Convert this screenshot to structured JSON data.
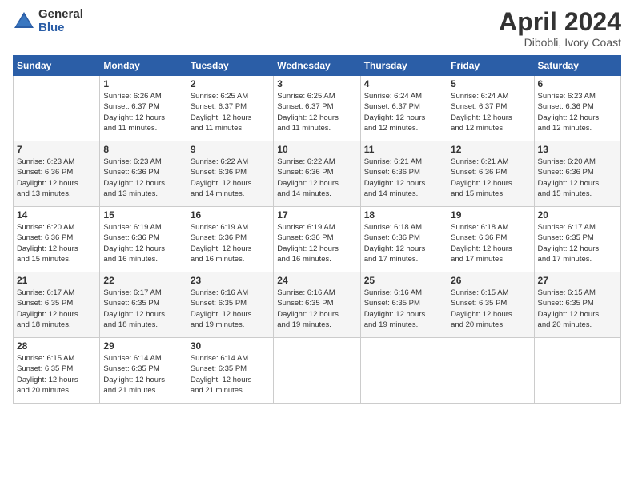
{
  "logo": {
    "general": "General",
    "blue": "Blue"
  },
  "title": {
    "month": "April 2024",
    "location": "Dibobli, Ivory Coast"
  },
  "days_header": [
    "Sunday",
    "Monday",
    "Tuesday",
    "Wednesday",
    "Thursday",
    "Friday",
    "Saturday"
  ],
  "weeks": [
    [
      {
        "day": "",
        "info": ""
      },
      {
        "day": "1",
        "info": "Sunrise: 6:26 AM\nSunset: 6:37 PM\nDaylight: 12 hours\nand 11 minutes."
      },
      {
        "day": "2",
        "info": "Sunrise: 6:25 AM\nSunset: 6:37 PM\nDaylight: 12 hours\nand 11 minutes."
      },
      {
        "day": "3",
        "info": "Sunrise: 6:25 AM\nSunset: 6:37 PM\nDaylight: 12 hours\nand 11 minutes."
      },
      {
        "day": "4",
        "info": "Sunrise: 6:24 AM\nSunset: 6:37 PM\nDaylight: 12 hours\nand 12 minutes."
      },
      {
        "day": "5",
        "info": "Sunrise: 6:24 AM\nSunset: 6:37 PM\nDaylight: 12 hours\nand 12 minutes."
      },
      {
        "day": "6",
        "info": "Sunrise: 6:23 AM\nSunset: 6:36 PM\nDaylight: 12 hours\nand 12 minutes."
      }
    ],
    [
      {
        "day": "7",
        "info": "Sunrise: 6:23 AM\nSunset: 6:36 PM\nDaylight: 12 hours\nand 13 minutes."
      },
      {
        "day": "8",
        "info": "Sunrise: 6:23 AM\nSunset: 6:36 PM\nDaylight: 12 hours\nand 13 minutes."
      },
      {
        "day": "9",
        "info": "Sunrise: 6:22 AM\nSunset: 6:36 PM\nDaylight: 12 hours\nand 14 minutes."
      },
      {
        "day": "10",
        "info": "Sunrise: 6:22 AM\nSunset: 6:36 PM\nDaylight: 12 hours\nand 14 minutes."
      },
      {
        "day": "11",
        "info": "Sunrise: 6:21 AM\nSunset: 6:36 PM\nDaylight: 12 hours\nand 14 minutes."
      },
      {
        "day": "12",
        "info": "Sunrise: 6:21 AM\nSunset: 6:36 PM\nDaylight: 12 hours\nand 15 minutes."
      },
      {
        "day": "13",
        "info": "Sunrise: 6:20 AM\nSunset: 6:36 PM\nDaylight: 12 hours\nand 15 minutes."
      }
    ],
    [
      {
        "day": "14",
        "info": "Sunrise: 6:20 AM\nSunset: 6:36 PM\nDaylight: 12 hours\nand 15 minutes."
      },
      {
        "day": "15",
        "info": "Sunrise: 6:19 AM\nSunset: 6:36 PM\nDaylight: 12 hours\nand 16 minutes."
      },
      {
        "day": "16",
        "info": "Sunrise: 6:19 AM\nSunset: 6:36 PM\nDaylight: 12 hours\nand 16 minutes."
      },
      {
        "day": "17",
        "info": "Sunrise: 6:19 AM\nSunset: 6:36 PM\nDaylight: 12 hours\nand 16 minutes."
      },
      {
        "day": "18",
        "info": "Sunrise: 6:18 AM\nSunset: 6:36 PM\nDaylight: 12 hours\nand 17 minutes."
      },
      {
        "day": "19",
        "info": "Sunrise: 6:18 AM\nSunset: 6:36 PM\nDaylight: 12 hours\nand 17 minutes."
      },
      {
        "day": "20",
        "info": "Sunrise: 6:17 AM\nSunset: 6:35 PM\nDaylight: 12 hours\nand 17 minutes."
      }
    ],
    [
      {
        "day": "21",
        "info": "Sunrise: 6:17 AM\nSunset: 6:35 PM\nDaylight: 12 hours\nand 18 minutes."
      },
      {
        "day": "22",
        "info": "Sunrise: 6:17 AM\nSunset: 6:35 PM\nDaylight: 12 hours\nand 18 minutes."
      },
      {
        "day": "23",
        "info": "Sunrise: 6:16 AM\nSunset: 6:35 PM\nDaylight: 12 hours\nand 19 minutes."
      },
      {
        "day": "24",
        "info": "Sunrise: 6:16 AM\nSunset: 6:35 PM\nDaylight: 12 hours\nand 19 minutes."
      },
      {
        "day": "25",
        "info": "Sunrise: 6:16 AM\nSunset: 6:35 PM\nDaylight: 12 hours\nand 19 minutes."
      },
      {
        "day": "26",
        "info": "Sunrise: 6:15 AM\nSunset: 6:35 PM\nDaylight: 12 hours\nand 20 minutes."
      },
      {
        "day": "27",
        "info": "Sunrise: 6:15 AM\nSunset: 6:35 PM\nDaylight: 12 hours\nand 20 minutes."
      }
    ],
    [
      {
        "day": "28",
        "info": "Sunrise: 6:15 AM\nSunset: 6:35 PM\nDaylight: 12 hours\nand 20 minutes."
      },
      {
        "day": "29",
        "info": "Sunrise: 6:14 AM\nSunset: 6:35 PM\nDaylight: 12 hours\nand 21 minutes."
      },
      {
        "day": "30",
        "info": "Sunrise: 6:14 AM\nSunset: 6:35 PM\nDaylight: 12 hours\nand 21 minutes."
      },
      {
        "day": "",
        "info": ""
      },
      {
        "day": "",
        "info": ""
      },
      {
        "day": "",
        "info": ""
      },
      {
        "day": "",
        "info": ""
      }
    ]
  ]
}
